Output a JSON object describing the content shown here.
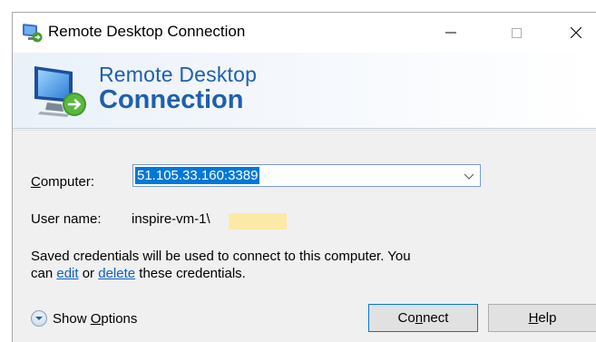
{
  "window": {
    "title": "Remote Desktop Connection",
    "controls": [
      "minimize",
      "maximize",
      "close"
    ]
  },
  "banner": {
    "line1": "Remote Desktop",
    "line2": "Connection"
  },
  "form": {
    "computer_label_accel": "C",
    "computer_label_rest": "omputer:",
    "computer_value": "51.105.33.160:3389",
    "user_label": "User name:",
    "user_value": "inspire-vm-1\\",
    "note_line1": "Saved credentials will be used to connect to this computer.  You",
    "note_prefix": "can ",
    "note_edit": "edit",
    "note_or": " or ",
    "note_delete": "delete",
    "note_suffix": " these credentials."
  },
  "footer": {
    "show_options_pre": "Show ",
    "show_options_accel": "O",
    "show_options_rest": "ptions",
    "connect_pre": "Co",
    "connect_accel": "n",
    "connect_rest": "nect",
    "help_accel": "H",
    "help_rest": "elp"
  },
  "colors": {
    "accent": "#1f5fad",
    "selection": "#0078d7",
    "link": "#0b5fc9",
    "redaction": "#fde9a7"
  },
  "icons": [
    "remote-desktop-icon",
    "minimize-icon",
    "maximize-icon",
    "close-icon",
    "chevron-down-icon",
    "expand-options-icon"
  ]
}
